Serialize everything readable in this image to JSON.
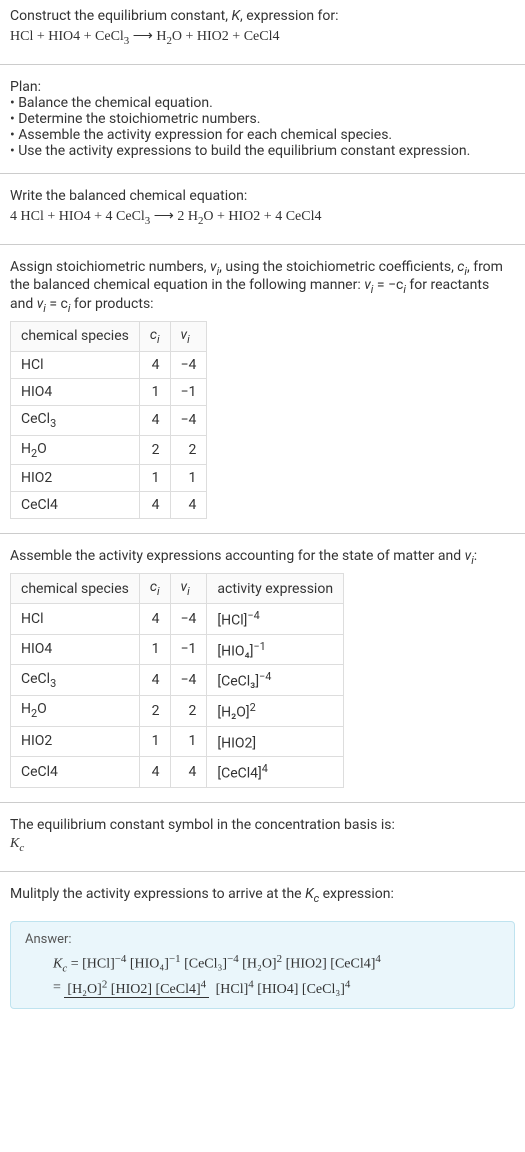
{
  "intro": {
    "line1_pre": "Construct the equilibrium constant, ",
    "line1_k": "K",
    "line1_post": ", expression for:",
    "equation_lhs": "HCl + HIO4 + CeCl",
    "equation_rhs": "H",
    "eq_lhs_full": "HCl + HIO4 + CeCl₃ ⟶ H₂O + HIO2 + CeCl4"
  },
  "plan": {
    "title": "Plan:",
    "b1": "Balance the chemical equation.",
    "b2": "Determine the stoichiometric numbers.",
    "b3": "Assemble the activity expression for each chemical species.",
    "b4": "Use the activity expressions to build the equilibrium constant expression."
  },
  "balanced": {
    "title": "Write the balanced chemical equation:",
    "eq": "4 HCl + HIO4 + 4 CeCl₃ ⟶ 2 H₂O + HIO2 + 4 CeCl4"
  },
  "assign": {
    "text_pre": "Assign stoichiometric numbers, ",
    "nu": "ν",
    "sub_i": "i",
    "text_mid1": ", using the stoichiometric coefficients, ",
    "c": "c",
    "text_mid2": ", from the balanced chemical equation in the following manner: ",
    "eq1_lhs": "ν",
    "eq1_rhs": " = −c",
    "text_mid3": " for reactants and ",
    "eq2": " = c",
    "text_post": " for products:"
  },
  "table1": {
    "headers": {
      "h1": "chemical species",
      "h2": "c",
      "h2sub": "i",
      "h3": "ν",
      "h3sub": "i"
    },
    "rows": [
      {
        "species": "HCl",
        "c": "4",
        "nu": "−4"
      },
      {
        "species": "HIO4",
        "c": "1",
        "nu": "−1"
      },
      {
        "species": "CeCl₃",
        "c": "4",
        "nu": "−4"
      },
      {
        "species": "H₂O",
        "c": "2",
        "nu": "2"
      },
      {
        "species": "HIO2",
        "c": "1",
        "nu": "1"
      },
      {
        "species": "CeCl4",
        "c": "4",
        "nu": "4"
      }
    ]
  },
  "assemble": {
    "text": "Assemble the activity expressions accounting for the state of matter and "
  },
  "table2": {
    "headers": {
      "h1": "chemical species",
      "h2": "c",
      "h2sub": "i",
      "h3": "ν",
      "h3sub": "i",
      "h4": "activity expression"
    },
    "rows": [
      {
        "species": "HCl",
        "c": "4",
        "nu": "−4",
        "act_base": "[HCl]",
        "act_sup": "−4"
      },
      {
        "species": "HIO4",
        "c": "1",
        "nu": "−1",
        "act_base": "[HIO₄]",
        "act_sup": "−1"
      },
      {
        "species": "CeCl₃",
        "c": "4",
        "nu": "−4",
        "act_base": "[CeCl₃]",
        "act_sup": "−4"
      },
      {
        "species": "H₂O",
        "c": "2",
        "nu": "2",
        "act_base": "[H₂O]",
        "act_sup": "2"
      },
      {
        "species": "HIO2",
        "c": "1",
        "nu": "1",
        "act_base": "[HIO2]",
        "act_sup": ""
      },
      {
        "species": "CeCl4",
        "c": "4",
        "nu": "4",
        "act_base": "[CeCl4]",
        "act_sup": "4"
      }
    ]
  },
  "eqconst": {
    "line1": "The equilibrium constant symbol in the concentration basis is:",
    "symbol": "K",
    "sub": "c"
  },
  "multiply": {
    "text_pre": "Mulitply the activity expressions to arrive at the ",
    "k": "K",
    "ksub": "c",
    "text_post": " expression:"
  },
  "answer": {
    "label": "Answer:",
    "kc": "K",
    "kcsub": "c",
    "line1_parts": [
      {
        "b": "[HCl]",
        "s": "−4"
      },
      {
        "b": " [HIO₄]",
        "s": "−1"
      },
      {
        "b": " [CeCl₃]",
        "s": "−4"
      },
      {
        "b": " [H₂O]",
        "s": "2"
      },
      {
        "b": " [HIO2]",
        "s": ""
      },
      {
        "b": " [CeCl4]",
        "s": "4"
      }
    ],
    "frac_num": [
      {
        "b": "[H₂O]",
        "s": "2"
      },
      {
        "b": " [HIO2]",
        "s": ""
      },
      {
        "b": " [CeCl4]",
        "s": "4"
      }
    ],
    "frac_den": [
      {
        "b": "[HCl]",
        "s": "4"
      },
      {
        "b": " [HIO4]",
        "s": ""
      },
      {
        "b": " [CeCl₃]",
        "s": "4"
      }
    ]
  }
}
